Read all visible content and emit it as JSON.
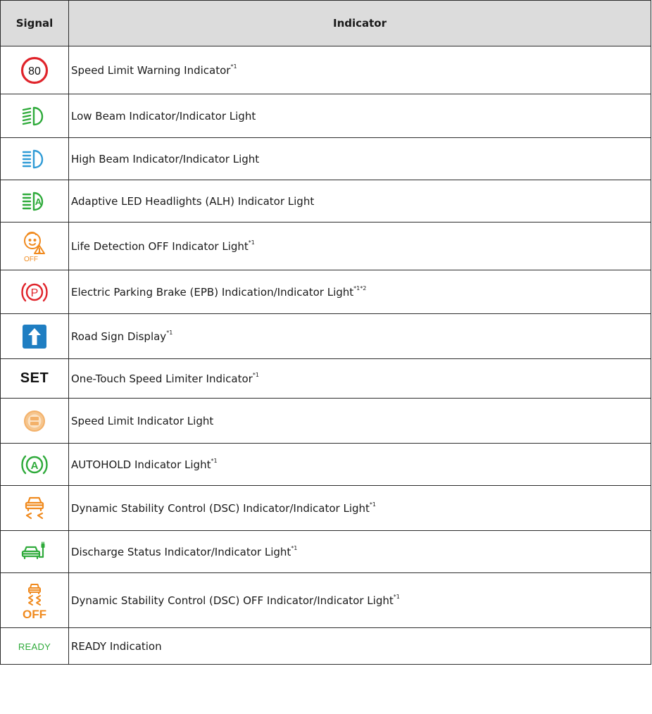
{
  "table": {
    "headers": {
      "signal": "Signal",
      "indicator": "Indicator"
    },
    "rows": [
      {
        "icon": "speed-limit-80-icon",
        "signal_text": "80",
        "label": "Speed Limit Warning Indicator",
        "sup": "*1"
      },
      {
        "icon": "low-beam-icon",
        "signal_text": "",
        "label": "Low Beam Indicator/Indicator Light",
        "sup": ""
      },
      {
        "icon": "high-beam-icon",
        "signal_text": "",
        "label": "High Beam Indicator/Indicator Light",
        "sup": ""
      },
      {
        "icon": "adaptive-headlight-icon",
        "signal_text": "A",
        "label": "Adaptive LED Headlights (ALH) Indicator Light",
        "sup": ""
      },
      {
        "icon": "life-detection-off-icon",
        "signal_text": "OFF",
        "label": "Life Detection OFF Indicator Light",
        "sup": "*1"
      },
      {
        "icon": "parking-brake-icon",
        "signal_text": "P",
        "label": "Electric Parking Brake (EPB) Indication/Indicator Light",
        "sup": "*1*2"
      },
      {
        "icon": "road-sign-arrow-icon",
        "signal_text": "",
        "label": "Road Sign Display",
        "sup": "*1"
      },
      {
        "icon": "set-text-icon",
        "signal_text": "SET",
        "label": "One-Touch Speed Limiter Indicator",
        "sup": "*1"
      },
      {
        "icon": "speed-limit-light-icon",
        "signal_text": "",
        "label": "Speed Limit Indicator Light",
        "sup": ""
      },
      {
        "icon": "autohold-icon",
        "signal_text": "A",
        "label": "AUTOHOLD Indicator Light",
        "sup": "*1"
      },
      {
        "icon": "dsc-icon",
        "signal_text": "",
        "label": "Dynamic Stability Control (DSC) Indicator/Indicator Light",
        "sup": "*1"
      },
      {
        "icon": "discharge-status-icon",
        "signal_text": "",
        "label": "Discharge Status Indicator/Indicator Light",
        "sup": "*1"
      },
      {
        "icon": "dsc-off-icon",
        "signal_text": "OFF",
        "label": "Dynamic Stability Control (DSC) OFF Indicator/Indicator Light",
        "sup": "*1"
      },
      {
        "icon": "ready-text-icon",
        "signal_text": "READY",
        "label": "READY Indication",
        "sup": ""
      }
    ]
  },
  "colors": {
    "red": "#e0242b",
    "green": "#2eaa3a",
    "blue": "#2f9bd6",
    "road_sign_blue": "#1f7ec2",
    "orange": "#f08a1e",
    "header_bg": "#dcdcdc"
  }
}
